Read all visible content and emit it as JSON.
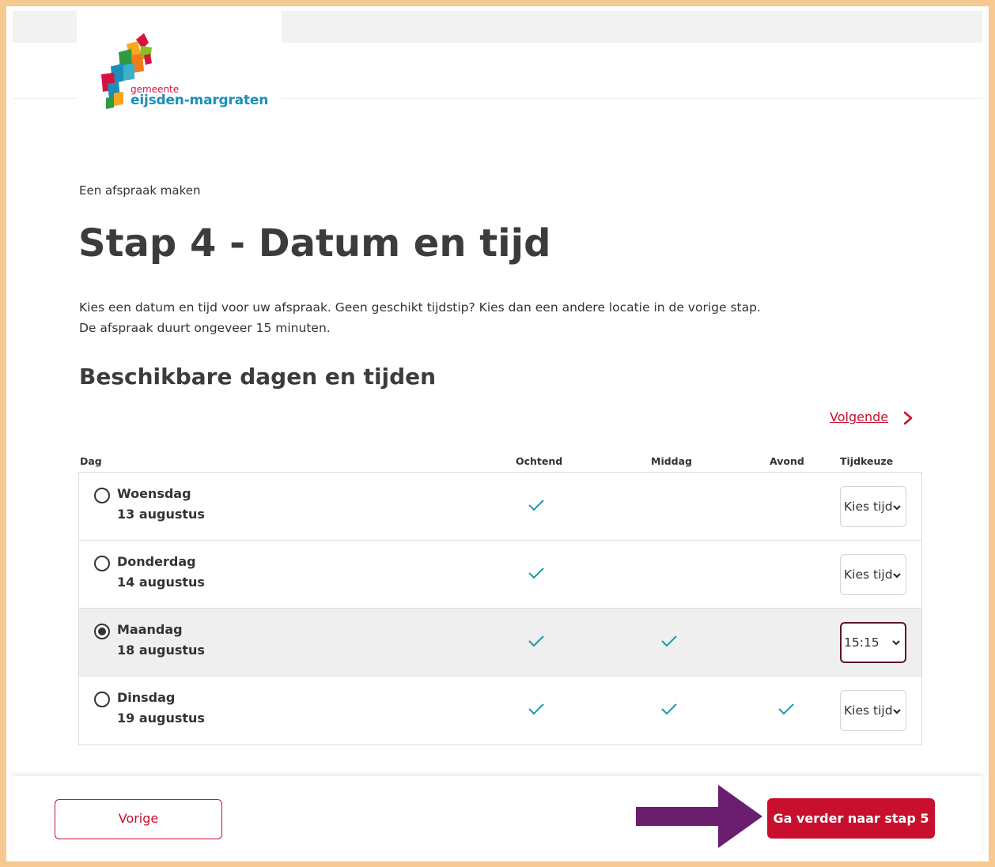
{
  "logo": {
    "small_text": "gemeente",
    "big_text": "eijsden-margraten"
  },
  "breadcrumb": "Een afspraak maken",
  "title": "Stap 4 - Datum en tijd",
  "intro": {
    "line1": "Kies een datum en tijd voor uw afspraak. Geen geschikt tijdstip? Kies dan een andere locatie in de vorige stap.",
    "line2": "De afspraak duurt ongeveer 15 minuten."
  },
  "section_title": "Beschikbare dagen en tijden",
  "next_link": "Volgende",
  "columns": {
    "day": "Dag",
    "morning": "Ochtend",
    "afternoon": "Middag",
    "evening": "Avond",
    "time_choice": "Tijdkeuze"
  },
  "rows": [
    {
      "day": "Woensdag",
      "date": "13 augustus",
      "morning": true,
      "afternoon": false,
      "evening": false,
      "selected": false,
      "time": "Kies tijd"
    },
    {
      "day": "Donderdag",
      "date": "14 augustus",
      "morning": true,
      "afternoon": false,
      "evening": false,
      "selected": false,
      "time": "Kies tijd"
    },
    {
      "day": "Maandag",
      "date": "18 augustus",
      "morning": true,
      "afternoon": true,
      "evening": false,
      "selected": true,
      "time": "15:15"
    },
    {
      "day": "Dinsdag",
      "date": "19 augustus",
      "morning": true,
      "afternoon": true,
      "evening": true,
      "selected": false,
      "time": "Kies tijd"
    }
  ],
  "footer": {
    "prev_label": "Vorige",
    "next_label": "Ga verder naar stap 5"
  },
  "colors": {
    "accent": "#c8102e",
    "check": "#1b9aaa",
    "arrow": "#6b1e6e",
    "frame": "#f5c990"
  }
}
